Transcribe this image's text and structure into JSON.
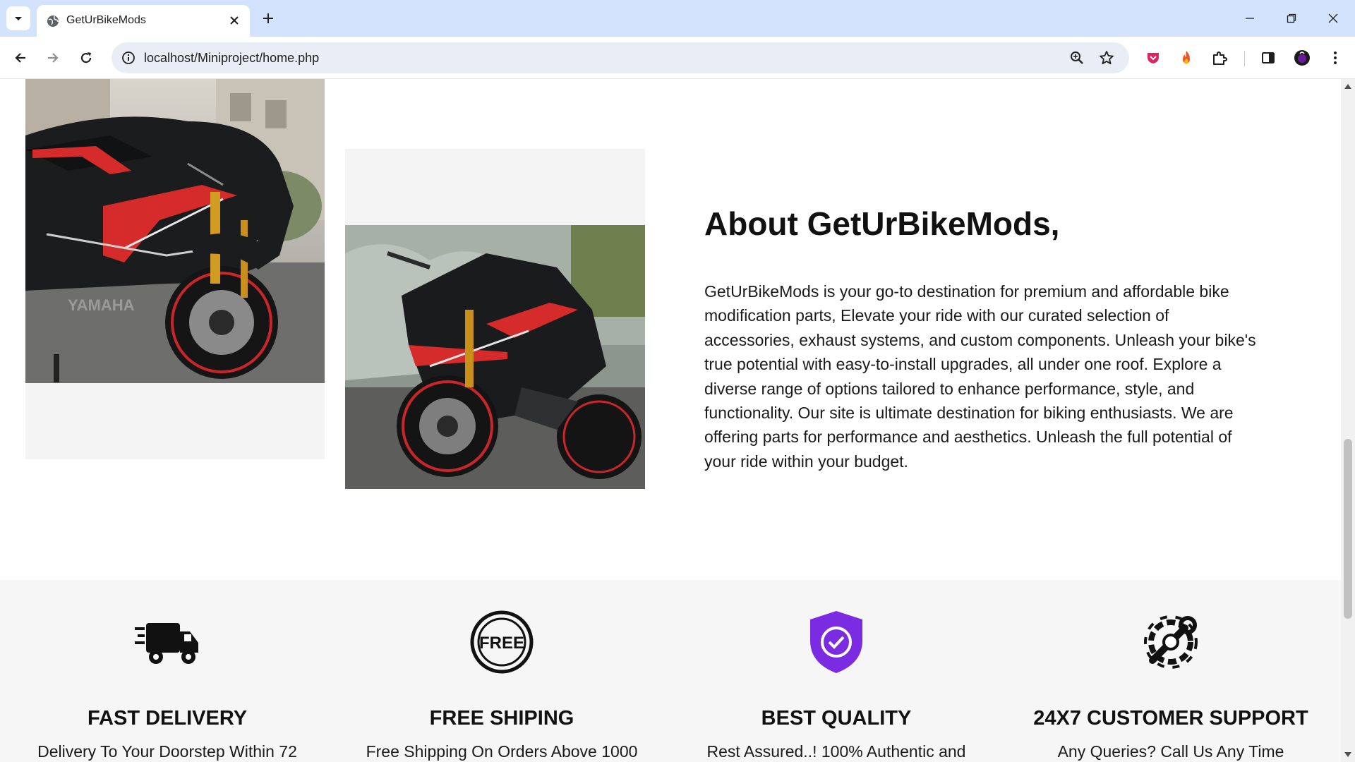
{
  "browser": {
    "tab_title": "GetUrBikeMods",
    "url": "localhost/Miniproject/home.php",
    "icons": {
      "tab_search": "chevron-down-icon",
      "favicon": "globe-icon",
      "close_tab": "close-icon",
      "new_tab": "plus-icon",
      "minimize": "minimize-icon",
      "restore": "restore-icon",
      "close_window": "close-icon",
      "back": "arrow-left-icon",
      "forward": "arrow-right-icon",
      "reload": "reload-icon",
      "site_info": "info-icon",
      "zoom": "zoom-icon",
      "bookmark": "star-icon",
      "extensions": [
        "shield-extension-icon",
        "flame-extension-icon",
        "puzzle-icon"
      ],
      "side_panel": "side-panel-icon",
      "profile": "avatar",
      "menu": "kebab-menu-icon"
    },
    "colors": {
      "tabbar_bg": "#d3e3fd",
      "omnibox_bg": "#e9eef6"
    }
  },
  "about": {
    "title": "About GetUrBikeMods,",
    "body": "GetUrBikeMods is your go-to destination for premium and affordable bike modification parts, Elevate your ride with our curated selection of accessories, exhaust systems, and custom components. Unleash your bike's true potential with easy-to-install upgrades, all under one roof. Explore a diverse range of options tailored to enhance performance, style, and functionality. Our site is ultimate destination for biking enthusiasts. We are offering parts for performance and aesthetics. Unleash the full potential of your ride within your budget.",
    "images": [
      {
        "alt": "black Yamaha sport bike with red decals, front three-quarter view",
        "badge_text": "YAMAHA"
      },
      {
        "alt": "black sport bike with red decals, side view"
      }
    ]
  },
  "features": [
    {
      "icon": "delivery-truck-icon",
      "title": "FAST DELIVERY",
      "desc": "Delivery To Your Doorstep Within 72"
    },
    {
      "icon": "free-badge-icon",
      "title": "FREE SHIPING",
      "desc": "Free Shipping On Orders Above 1000"
    },
    {
      "icon": "quality-shield-icon",
      "title": "BEST QUALITY",
      "desc": "Rest Assured..! 100% Authentic and",
      "color": "#7b2be2"
    },
    {
      "icon": "gear-wrench-icon",
      "title": "24X7 CUSTOMER SUPPORT",
      "desc": "Any Queries? Call Us Any Time"
    }
  ]
}
